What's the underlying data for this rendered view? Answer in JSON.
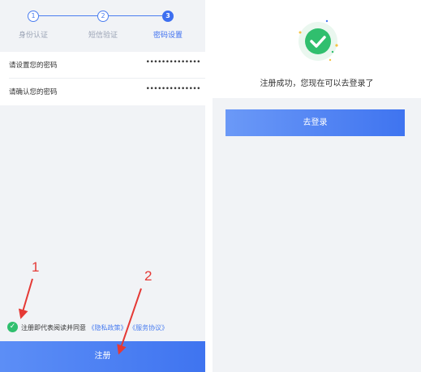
{
  "steps": [
    {
      "number": "1",
      "label": "身份认证"
    },
    {
      "number": "2",
      "label": "短信验证"
    },
    {
      "number": "3",
      "label": "密码设置"
    }
  ],
  "form": {
    "password_label": "请设置您的密码",
    "password_value": "••••••••••••••",
    "confirm_label": "请确认您的密码",
    "confirm_value": "••••••••••••••"
  },
  "agreement": {
    "text": "注册即代表阅读并同意",
    "privacy_link": "《隐私政策》",
    "service_link": "《服务协议》"
  },
  "register_button": "注册",
  "annotations": {
    "label_1": "1",
    "label_2": "2"
  },
  "success": {
    "message": "注册成功，您现在可以去登录了",
    "login_button": "去登录"
  },
  "colors": {
    "primary": "#3d6ff0",
    "success": "#30bf6e",
    "annotation": "#e53935",
    "background": "#f1f3f6"
  },
  "icons": [
    "check-circle-icon",
    "success-check-icon"
  ]
}
